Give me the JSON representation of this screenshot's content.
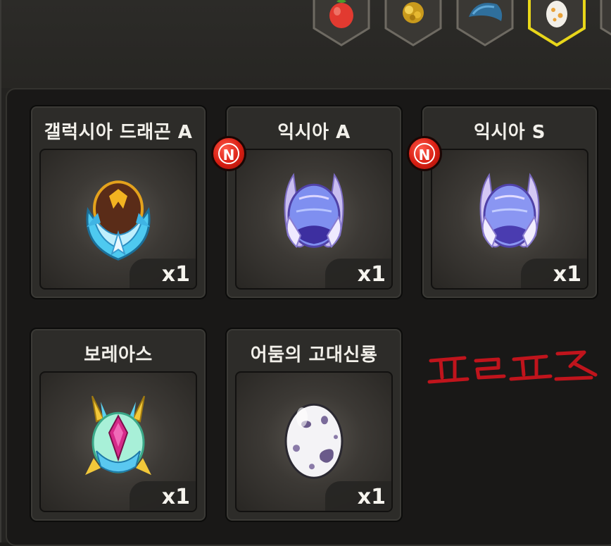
{
  "category_tabs": [
    {
      "name": "fruit",
      "icon": "red-fruit-icon",
      "selected": false
    },
    {
      "name": "gold",
      "icon": "gold-nugget-icon",
      "selected": false
    },
    {
      "name": "scale",
      "icon": "blue-scale-icon",
      "selected": false
    },
    {
      "name": "egg",
      "icon": "spotted-egg-icon",
      "selected": true
    }
  ],
  "items": [
    {
      "title": "갤럭시아 드래곤 A",
      "quantity": "x1",
      "is_new": false,
      "icon": "galaxia-dragon-egg-icon"
    },
    {
      "title": "익시아 A",
      "quantity": "x1",
      "is_new": true,
      "icon": "ixia-egg-icon"
    },
    {
      "title": "익시아 S",
      "quantity": "x1",
      "is_new": true,
      "icon": "ixia-egg-icon"
    },
    {
      "title": "보레아스",
      "quantity": "x1",
      "is_new": false,
      "icon": "boreas-egg-icon"
    },
    {
      "title": "어둠의 고대신룡",
      "quantity": "x1",
      "is_new": false,
      "icon": "dark-ancient-dragon-egg-icon"
    }
  ],
  "new_badge_label": "N",
  "handwritten_annotation": "프르프즈",
  "colors": {
    "selected_tab_border": "#e8d61a",
    "new_badge": "#d81e12",
    "handwriting": "#c0141c"
  }
}
